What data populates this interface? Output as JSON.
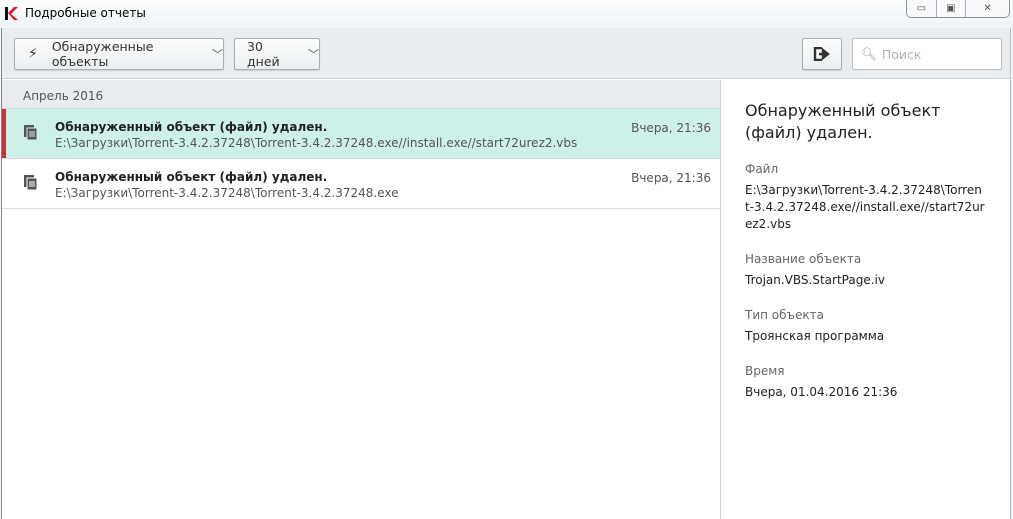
{
  "window": {
    "title": "Подробные отчеты"
  },
  "toolbar": {
    "filter_label": "Обнаруженные объекты",
    "period_label": "30 дней",
    "search_placeholder": "Поиск"
  },
  "list": {
    "section": "Апрель 2016",
    "items": [
      {
        "title": "Обнаруженный объект (файл) удален.",
        "path": "E:\\Загрузки\\Torrent-3.4.2.37248\\Torrent-3.4.2.37248.exe//install.exe//start72urez2.vbs",
        "time": "Вчера, 21:36",
        "selected": true
      },
      {
        "title": "Обнаруженный объект (файл) удален.",
        "path": "E:\\Загрузки\\Torrent-3.4.2.37248\\Torrent-3.4.2.37248.exe",
        "time": "Вчера, 21:36",
        "selected": false
      }
    ]
  },
  "details": {
    "title": "Обнаруженный объект (файл) удален.",
    "fields": [
      {
        "label": "Файл",
        "value": "E:\\Загрузки\\Torrent-3.4.2.37248\\Torrent-3.4.2.37248.exe//install.exe//start72urez2.vbs"
      },
      {
        "label": "Название объекта",
        "value": "Trojan.VBS.StartPage.iv"
      },
      {
        "label": "Тип объекта",
        "value": "Троянская программа"
      },
      {
        "label": "Время",
        "value": "Вчера, 01.04.2016 21:36"
      }
    ]
  },
  "colors": {
    "selected_row": "#cdf1e8",
    "accent": "#c8323c"
  }
}
